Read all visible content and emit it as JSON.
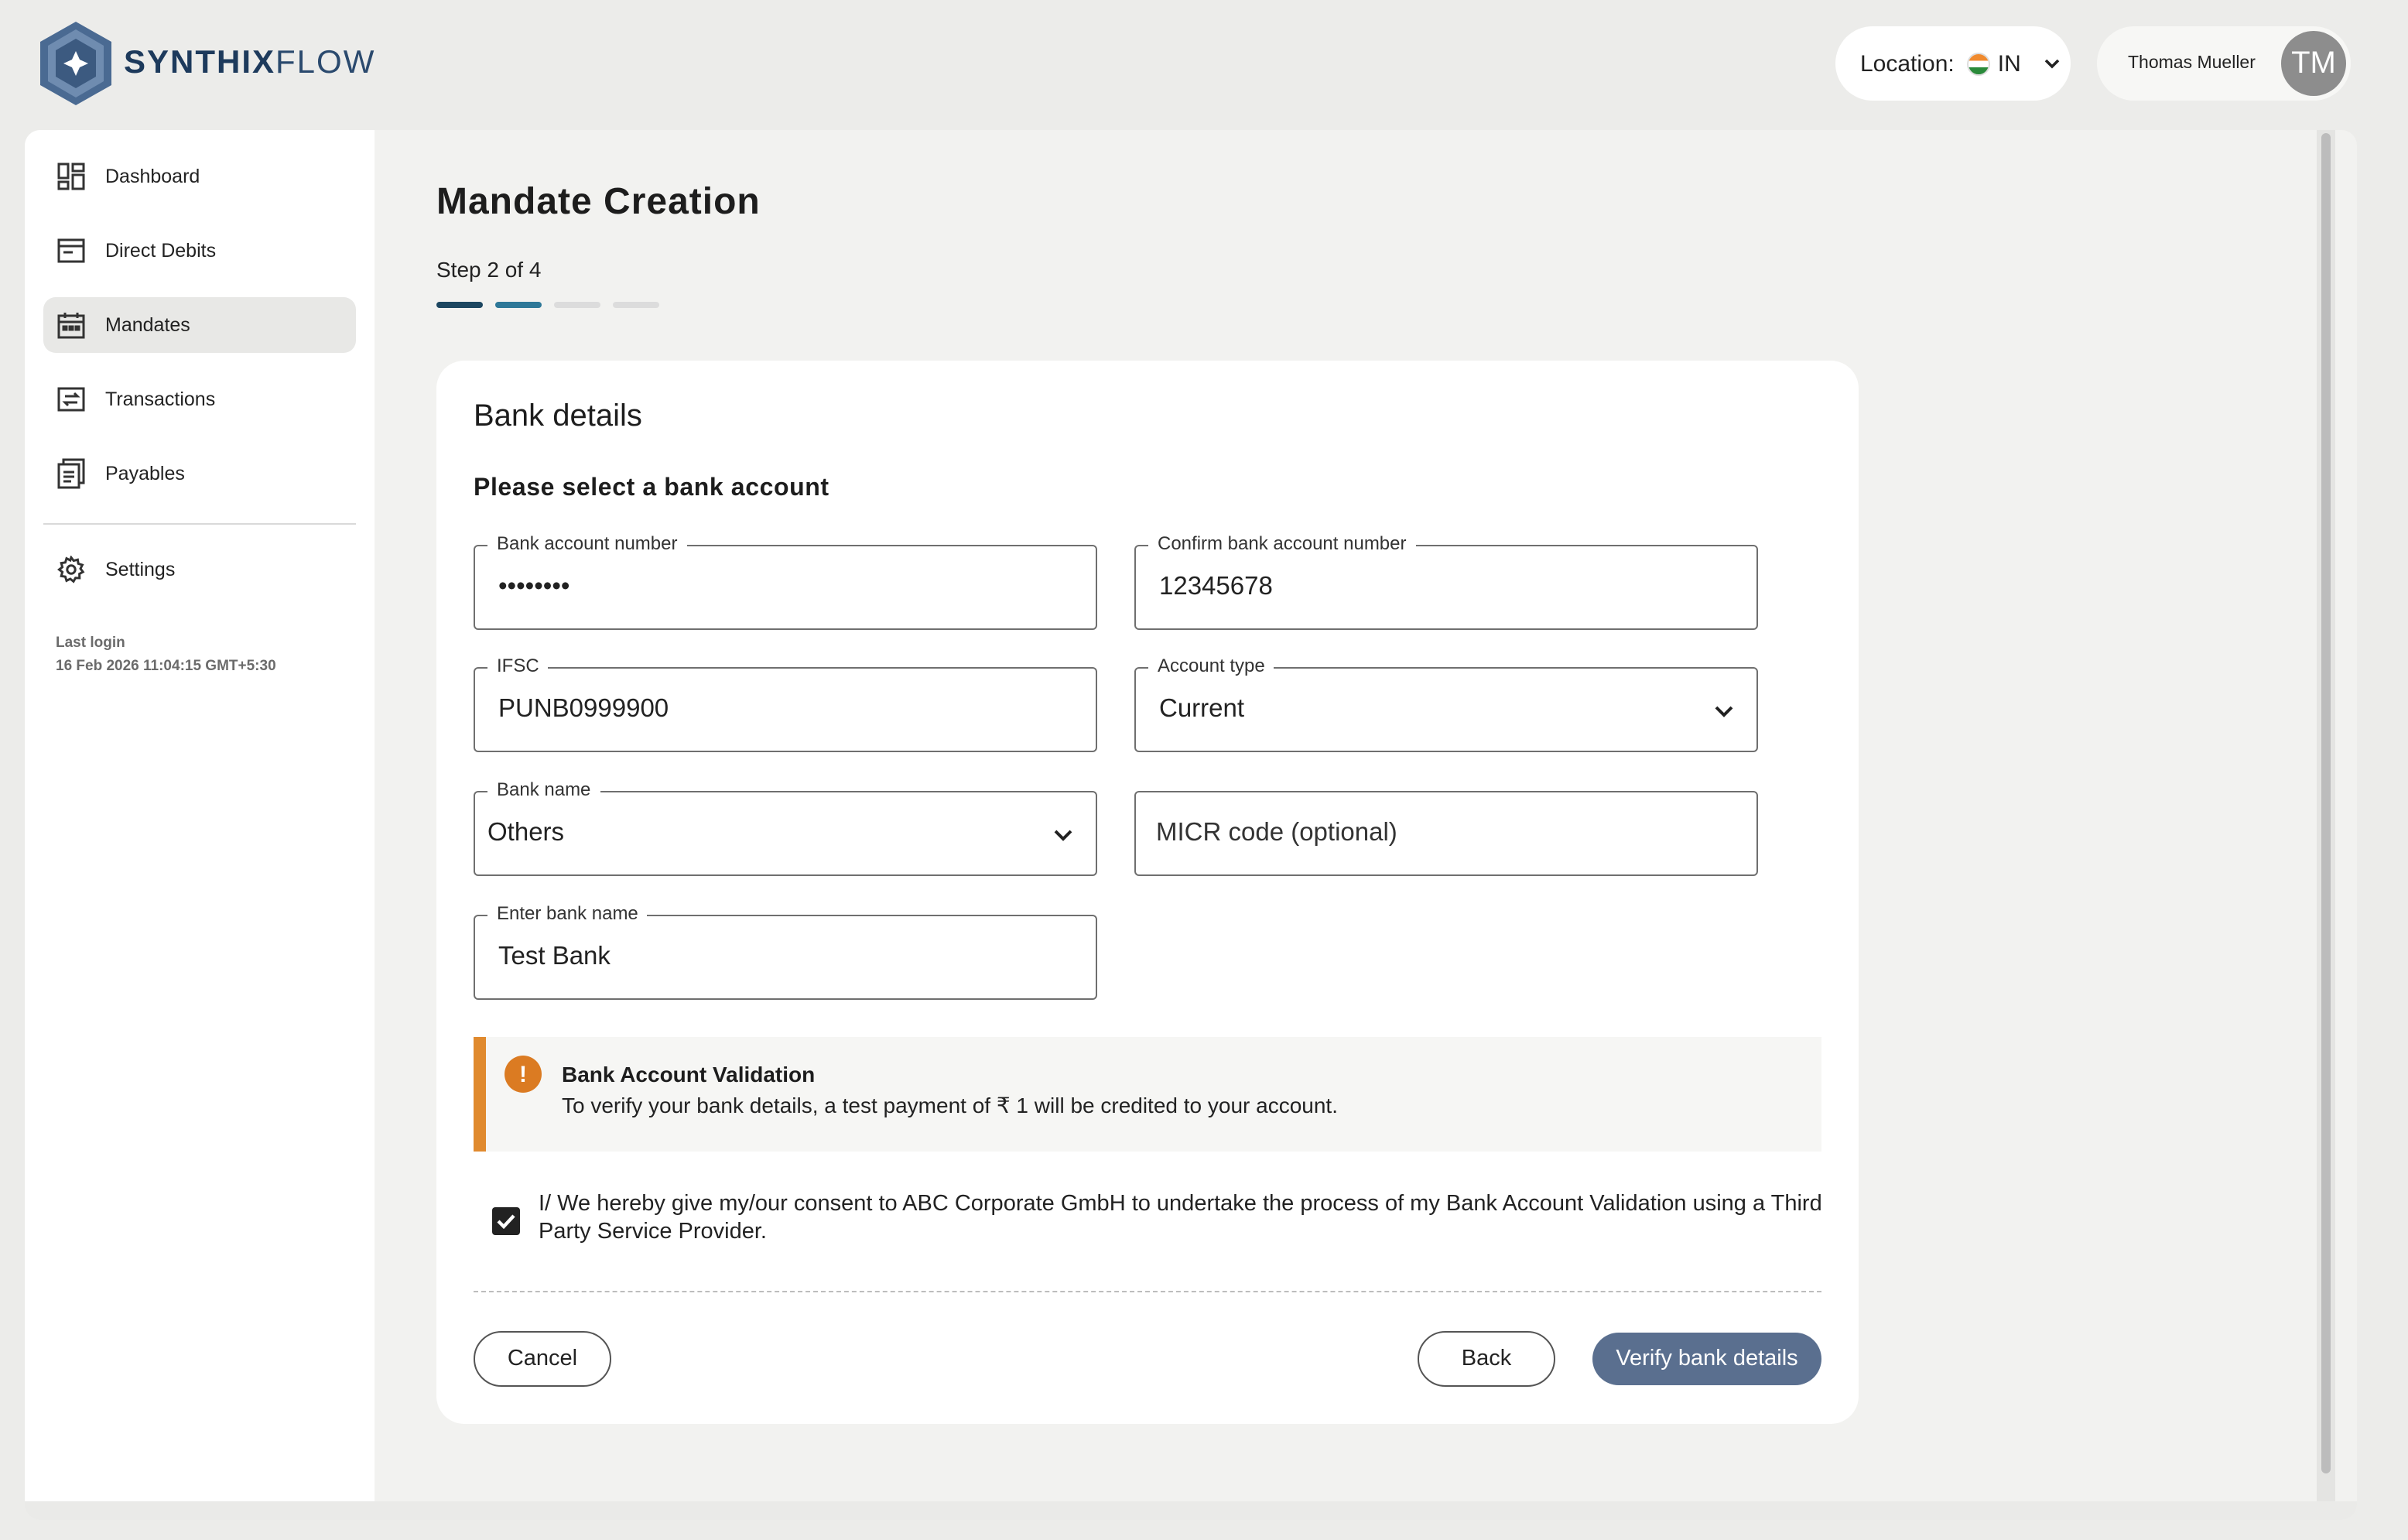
{
  "brand": {
    "name_bold": "SYNTHIX",
    "name_light": "FLOW"
  },
  "header": {
    "location_label": "Location:",
    "location_code": "IN",
    "user_name": "Thomas Mueller",
    "user_initials": "TM"
  },
  "sidebar": {
    "items": [
      {
        "label": "Dashboard",
        "icon": "dashboard-icon"
      },
      {
        "label": "Direct Debits",
        "icon": "direct-debits-icon"
      },
      {
        "label": "Mandates",
        "icon": "calendar-icon",
        "active": true
      },
      {
        "label": "Transactions",
        "icon": "transactions-icon"
      },
      {
        "label": "Payables",
        "icon": "payables-icon"
      }
    ],
    "settings_label": "Settings",
    "last_login_label": "Last login",
    "last_login_value": "16 Feb 2026 11:04:15 GMT+5:30"
  },
  "page": {
    "title": "Mandate Creation",
    "step_text": "Step 2 of 4",
    "step_colors": [
      "#1c4660",
      "#2e7898",
      "#dcdcdc",
      "#dcdcdc"
    ]
  },
  "card": {
    "heading": "Bank details",
    "subheading": "Please select a bank account",
    "fields": {
      "account_number": {
        "label": "Bank account number",
        "value": "••••••••"
      },
      "confirm_account_number": {
        "label": "Confirm bank account number",
        "value": "12345678"
      },
      "ifsc": {
        "label": "IFSC",
        "value": "PUNB0999900"
      },
      "account_type": {
        "label": "Account type",
        "value": "Current"
      },
      "bank_name": {
        "label": "Bank name",
        "value": "Others"
      },
      "micr": {
        "placeholder": "MICR code (optional)"
      },
      "enter_bank_name": {
        "label": "Enter bank name",
        "value": "Test Bank"
      }
    },
    "alert": {
      "title": "Bank Account Validation",
      "text": "To verify your bank details, a test payment of ₹ 1 will be credited to your account.",
      "color": "#e08a2e"
    },
    "consent": {
      "checked": true,
      "text": "I/ We hereby give my/our consent to ABC Corporate GmbH to undertake the process of my Bank Account Validation using a Third Party Service Provider."
    },
    "buttons": {
      "cancel": "Cancel",
      "back": "Back",
      "verify": "Verify bank details"
    }
  }
}
